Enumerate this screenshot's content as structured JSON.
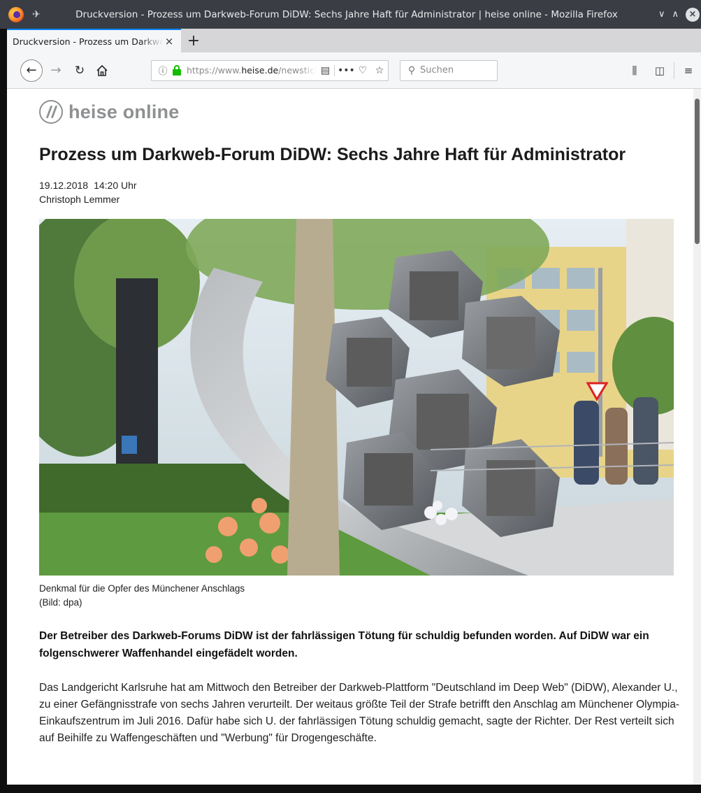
{
  "window": {
    "title": "Druckversion - Prozess um Darkweb-Forum DiDW: Sechs Jahre Haft für Administrator | heise online - Mozilla Firefox",
    "minimize_glyph": "∨",
    "maximize_glyph": "∧",
    "close_glyph": "×"
  },
  "tabs": [
    {
      "title": "Druckversion - Prozess um Darkweb-Forum DiDW",
      "active": true
    }
  ],
  "tab_close_glyph": "×",
  "new_tab_glyph": "+",
  "toolbar": {
    "url_prefix": "https://www.",
    "url_host": "heise.de",
    "url_path": "/newsticker",
    "search_placeholder": "Suchen",
    "icons": [
      "back-icon",
      "forward-icon",
      "reload-icon",
      "home-icon",
      "info-icon",
      "lock-icon",
      "reader-view-icon",
      "page-actions-icon",
      "pocket-icon",
      "bookmark-star-icon",
      "search-icon",
      "library-icon",
      "sidebar-icon",
      "menu-icon"
    ]
  },
  "page": {
    "logo_text": "heise online",
    "headline": "Prozess um Darkweb-Forum DiDW: Sechs Jahre Haft für Administrator",
    "date": "19.12.2018",
    "time": "14:20 Uhr",
    "author": "Christoph Lemmer",
    "image_caption": "Denkmal für die Opfer des Münchener Anschlags",
    "image_credit": "(Bild: dpa)",
    "lead": "Der Betreiber des Darkweb-Forums DiDW ist der fahrlässigen Tötung für schuldig befunden worden. Auf DiDW war ein folgenschwerer Waffenhandel eingefädelt worden.",
    "body": "Das Landgericht Karlsruhe hat am Mittwoch den Betreiber der Darkweb-Plattform \"Deutschland im Deep Web\" (DiDW), Alexander U., zu einer Gefängnisstrafe von sechs Jahren verurteilt. Der weitaus größte Teil der Strafe betrifft den Anschlag am Münchener Olympia-Einkaufszentrum im Juli 2016. Dafür habe sich U. der fahrlässigen Tötung schuldig gemacht, sagte der Richter. Der Rest verteilt sich auf Beihilfe zu Waffengeschäften und \"Werbung\" für Drogengeschäfte."
  },
  "colors": {
    "titlebar": "#3a3e44",
    "tab_accent": "#0a84ff",
    "lock_green": "#12bc00",
    "logo_gray": "#8e9092"
  }
}
